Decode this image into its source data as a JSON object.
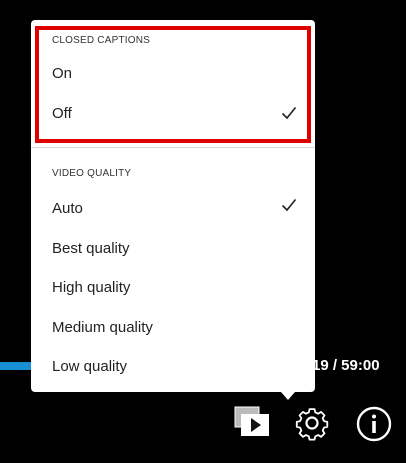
{
  "player": {
    "time": "19 / 59:00",
    "progress_color": "#1a8ed4"
  },
  "menu": {
    "closed_captions": {
      "header": "CLOSED CAPTIONS",
      "items": [
        {
          "label": "On",
          "selected": false
        },
        {
          "label": "Off",
          "selected": true
        }
      ]
    },
    "video_quality": {
      "header": "VIDEO QUALITY",
      "items": [
        {
          "label": "Auto",
          "selected": true
        },
        {
          "label": "Best quality",
          "selected": false
        },
        {
          "label": "High quality",
          "selected": false
        },
        {
          "label": "Medium quality",
          "selected": false
        },
        {
          "label": "Low quality",
          "selected": false
        }
      ]
    },
    "highlight_color": "#e00000"
  },
  "controls": {
    "icons": [
      "picture-in-picture-icon",
      "settings-gear-icon",
      "info-icon"
    ]
  }
}
